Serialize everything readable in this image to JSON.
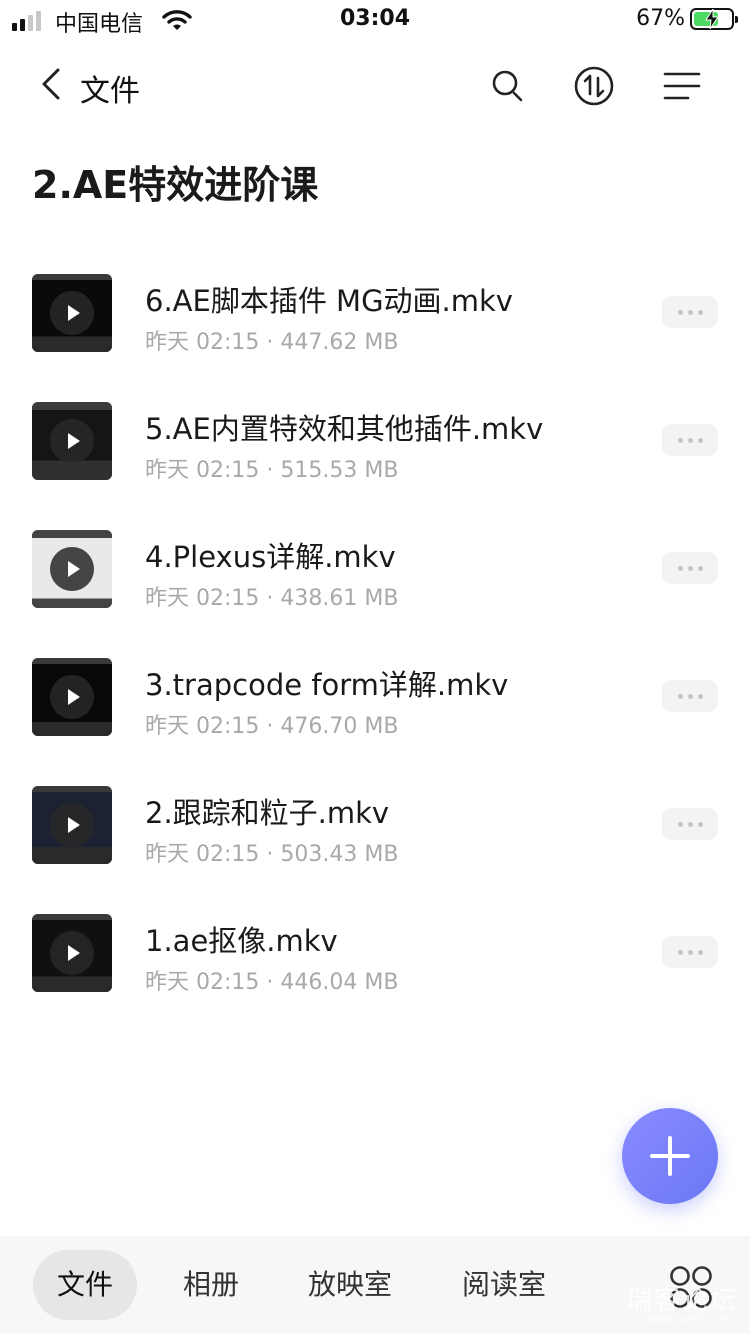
{
  "status_bar": {
    "carrier": "中国电信",
    "time": "03:04",
    "battery_percent": "67%",
    "battery_level": 0.67,
    "icons": [
      "signal-icon",
      "wifi-icon",
      "battery-charging-icon"
    ]
  },
  "nav": {
    "back_label": "文件",
    "icons": [
      "back-chevron-icon",
      "search-icon",
      "sort-icon",
      "menu-icon"
    ]
  },
  "folder_title": "2.AE特效进阶课",
  "files": [
    {
      "name": "6.AE脚本插件 MG动画.mkv",
      "date": "昨天 02:15",
      "size": "447.62 MB",
      "separator": "·"
    },
    {
      "name": "5.AE内置特效和其他插件.mkv",
      "date": "昨天 02:15",
      "size": "515.53 MB",
      "separator": "·"
    },
    {
      "name": "4.Plexus详解.mkv",
      "date": "昨天 02:15",
      "size": "438.61 MB",
      "separator": "·"
    },
    {
      "name": "3.trapcode form详解.mkv",
      "date": "昨天 02:15",
      "size": "476.70 MB",
      "separator": "·"
    },
    {
      "name": "2.跟踪和粒子.mkv",
      "date": "昨天 02:15",
      "size": "503.43 MB",
      "separator": "·"
    },
    {
      "name": "1.ae抠像.mkv",
      "date": "昨天 02:15",
      "size": "446.04 MB",
      "separator": "·"
    }
  ],
  "fab_icon": "plus-icon",
  "tabs": [
    {
      "label": "文件",
      "active": true
    },
    {
      "label": "相册",
      "active": false
    },
    {
      "label": "放映室",
      "active": false
    },
    {
      "label": "阅读室",
      "active": false
    }
  ],
  "tab_more_icon": "apps-grid-icon",
  "watermark": {
    "text": "瑞客论坛",
    "sub": "www.ruike1.com"
  },
  "colors": {
    "accent": "#7580f6",
    "meta_text": "#a9a9a9",
    "tab_bar_bg": "#f7f7f7",
    "active_tab_bg": "#e6e6e6"
  }
}
